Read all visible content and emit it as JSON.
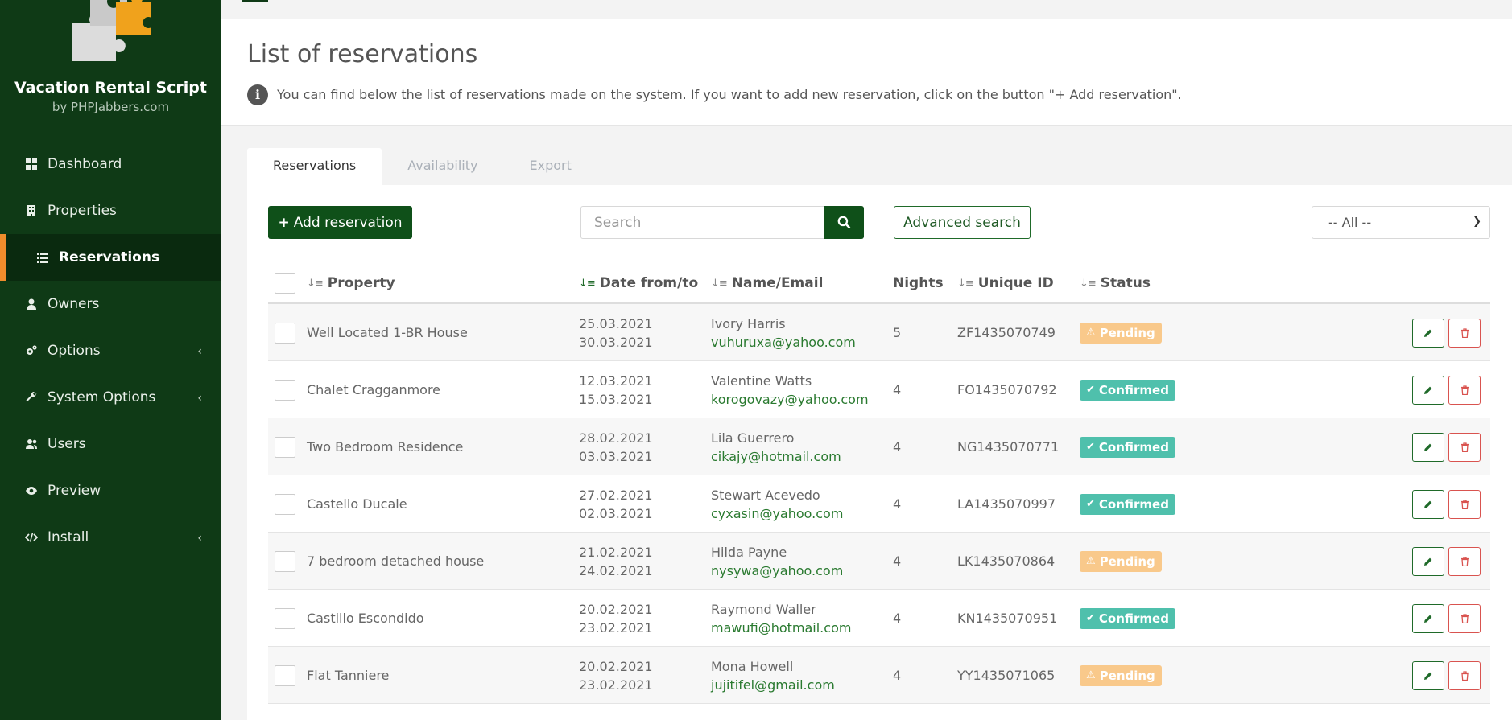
{
  "brand": {
    "title": "Vacation Rental Script",
    "subtitle": "by PHPJabbers.com"
  },
  "sidebar": {
    "items": [
      {
        "label": "Dashboard",
        "icon": "dashboard-icon",
        "active": false,
        "submenu": false
      },
      {
        "label": "Properties",
        "icon": "building-icon",
        "active": false,
        "submenu": false
      },
      {
        "label": "Reservations",
        "icon": "list-icon",
        "active": true,
        "submenu": false
      },
      {
        "label": "Owners",
        "icon": "user-icon",
        "active": false,
        "submenu": false
      },
      {
        "label": "Options",
        "icon": "gears-icon",
        "active": false,
        "submenu": true
      },
      {
        "label": "System Options",
        "icon": "wrench-icon",
        "active": false,
        "submenu": true
      },
      {
        "label": "Users",
        "icon": "users-icon",
        "active": false,
        "submenu": false
      },
      {
        "label": "Preview",
        "icon": "eye-icon",
        "active": false,
        "submenu": false
      },
      {
        "label": "Install",
        "icon": "code-icon",
        "active": false,
        "submenu": true
      }
    ]
  },
  "page": {
    "title": "List of reservations",
    "description": "You can find below the list of reservations made on the system. If you want to add new reservation, click on the button \"+ Add reservation\"."
  },
  "tabs": [
    {
      "label": "Reservations",
      "active": true
    },
    {
      "label": "Availability",
      "active": false
    },
    {
      "label": "Export",
      "active": false
    }
  ],
  "toolbar": {
    "add_label": "Add reservation",
    "search_placeholder": "Search",
    "advanced_label": "Advanced search",
    "filter_value": "-- All --"
  },
  "table": {
    "headers": {
      "property": "Property",
      "dates": "Date from/to",
      "name": "Name/Email",
      "nights": "Nights",
      "uid": "Unique ID",
      "status": "Status"
    },
    "rows": [
      {
        "property": "Well Located 1-BR House",
        "from": "25.03.2021",
        "to": "30.03.2021",
        "name": "Ivory Harris",
        "email": "vuhuruxa@yahoo.com",
        "nights": "5",
        "uid": "ZF1435070749",
        "status": "Pending"
      },
      {
        "property": "Chalet Cragganmore",
        "from": "12.03.2021",
        "to": "15.03.2021",
        "name": "Valentine Watts",
        "email": "korogovazy@yahoo.com",
        "nights": "4",
        "uid": "FO1435070792",
        "status": "Confirmed"
      },
      {
        "property": "Two Bedroom Residence",
        "from": "28.02.2021",
        "to": "03.03.2021",
        "name": "Lila Guerrero",
        "email": "cikajy@hotmail.com",
        "nights": "4",
        "uid": "NG1435070771",
        "status": "Confirmed"
      },
      {
        "property": "Castello Ducale",
        "from": "27.02.2021",
        "to": "02.03.2021",
        "name": "Stewart Acevedo",
        "email": "cyxasin@yahoo.com",
        "nights": "4",
        "uid": "LA1435070997",
        "status": "Confirmed"
      },
      {
        "property": "7 bedroom detached house",
        "from": "21.02.2021",
        "to": "24.02.2021",
        "name": "Hilda Payne",
        "email": "nysywa@yahoo.com",
        "nights": "4",
        "uid": "LK1435070864",
        "status": "Pending"
      },
      {
        "property": "Castillo Escondido",
        "from": "20.02.2021",
        "to": "23.02.2021",
        "name": "Raymond Waller",
        "email": "mawufi@hotmail.com",
        "nights": "4",
        "uid": "KN1435070951",
        "status": "Confirmed"
      },
      {
        "property": "Flat Tanniere",
        "from": "20.02.2021",
        "to": "23.02.2021",
        "name": "Mona Howell",
        "email": "jujitifel@gmail.com",
        "nights": "4",
        "uid": "YY1435071065",
        "status": "Pending"
      }
    ]
  },
  "colors": {
    "sidebar_bg": "#0f3a16",
    "accent_orange": "#f08c2c",
    "primary_green": "#0f5019",
    "pending": "#f9c98b",
    "confirmed": "#4fc0ac",
    "delete_red": "#d9534f"
  }
}
